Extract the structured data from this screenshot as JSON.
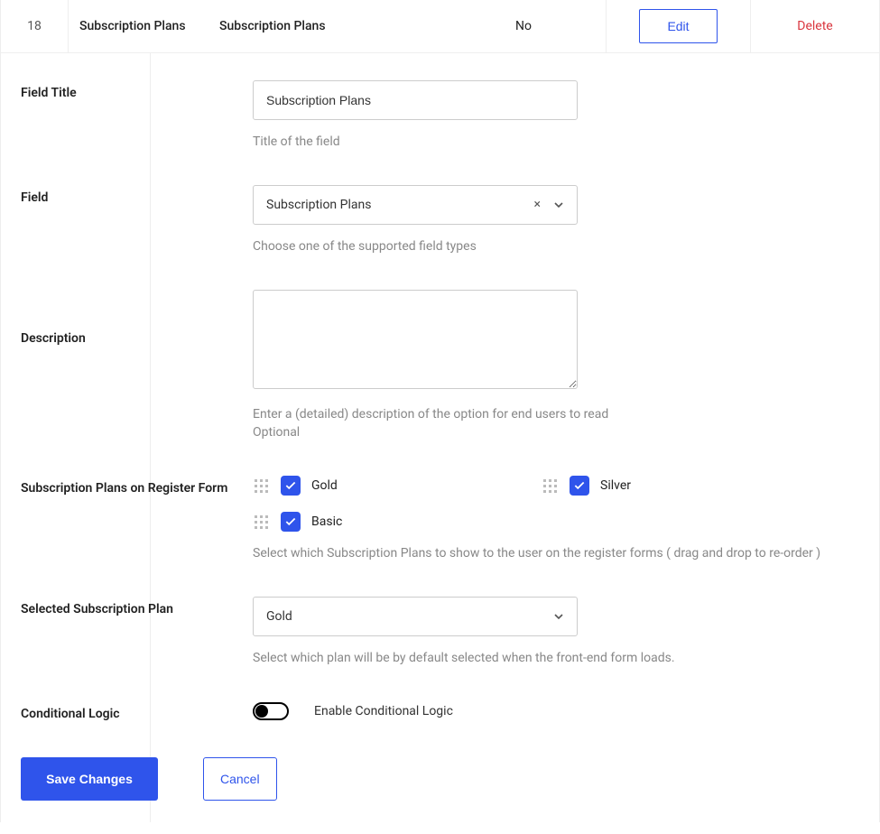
{
  "row": {
    "number": "18",
    "title": "Subscription Plans",
    "type": "Subscription Plans",
    "required": "No",
    "edit": "Edit",
    "delete": "Delete"
  },
  "labels": {
    "field_title": "Field Title",
    "field": "Field",
    "description": "Description",
    "plans_on_form": "Subscription Plans on Register Form",
    "selected_plan": "Selected Subscription Plan",
    "conditional_logic": "Conditional Logic"
  },
  "fields": {
    "field_title_value": "Subscription Plans",
    "field_title_hint": "Title of the field",
    "field_type_value": "Subscription Plans",
    "field_type_hint": "Choose one of the supported field types",
    "description_hint_line1": "Enter a (detailed) description of the option for end users to read",
    "description_hint_line2": "Optional",
    "plans_hint": "Select which Subscription Plans to show to the user on the register forms ( drag and drop to re-order )",
    "selected_plan_value": "Gold",
    "selected_plan_hint": "Select which plan will be by default selected when the front-end form loads.",
    "conditional_toggle_label": "Enable Conditional Logic"
  },
  "plan_list": {
    "p0": "Gold",
    "p1": "Silver",
    "p2": "Basic"
  },
  "buttons": {
    "save": "Save Changes",
    "cancel": "Cancel"
  }
}
